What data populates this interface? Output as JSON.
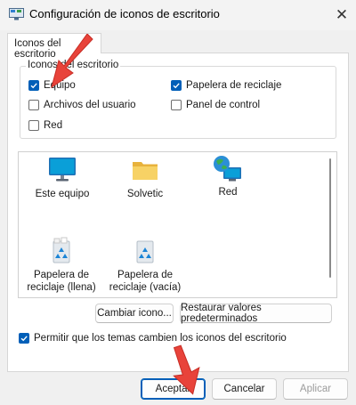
{
  "window": {
    "title": "Configuración de iconos de escritorio",
    "close_symbol": "✕"
  },
  "tab": {
    "label": "Iconos del escritorio"
  },
  "group": {
    "legend": "Iconos del escritorio",
    "checkboxes": [
      {
        "label": "Equipo",
        "checked": true
      },
      {
        "label": "Papelera de reciclaje",
        "checked": true
      },
      {
        "label": "Archivos del usuario",
        "checked": false
      },
      {
        "label": "Panel de control",
        "checked": false
      },
      {
        "label": "Red",
        "checked": false
      }
    ]
  },
  "icons": [
    {
      "label": "Este equipo",
      "icon": "monitor-icon"
    },
    {
      "label": "Solvetic",
      "icon": "folder-icon"
    },
    {
      "label": "Red",
      "icon": "network-globe-icon"
    },
    {
      "label": "Papelera de reciclaje (llena)",
      "icon": "recycle-bin-full-icon"
    },
    {
      "label": "Papelera de reciclaje (vacía)",
      "icon": "recycle-bin-empty-icon"
    }
  ],
  "buttons": {
    "change_icon": "Cambiar icono...",
    "restore_defaults": "Restaurar valores predeterminados",
    "ok": "Aceptar",
    "cancel": "Cancelar",
    "apply": "Aplicar"
  },
  "allow_themes": {
    "label": "Permitir que los temas cambien los iconos del escritorio",
    "checked": true
  },
  "colors": {
    "accent": "#005fb8",
    "annotation_arrow": "#e8433a"
  }
}
